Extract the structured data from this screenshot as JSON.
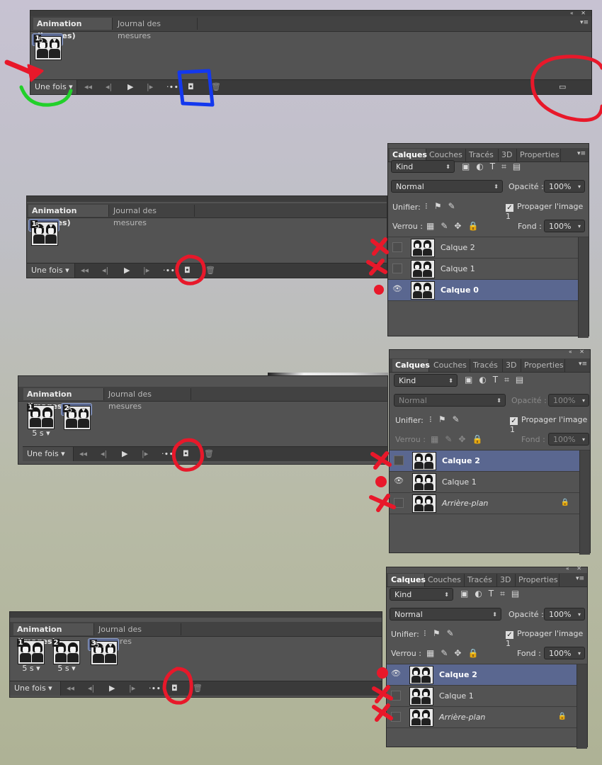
{
  "tabs": {
    "animation": "Animation (images)",
    "journal": "Journal des mesures"
  },
  "loop_label": "Une fois",
  "frame_duration": "5 s",
  "frame_numbers": [
    "1",
    "2",
    "3"
  ],
  "layer_tabs": [
    "Calques",
    "Couches",
    "Tracés",
    "3D",
    "Properties"
  ],
  "filter_kind": "Kind",
  "blend_mode": "Normal",
  "opacity_label": "Opacité :",
  "opacity_value": "100%",
  "unify_label": "Unifier:",
  "propagate_label": "Propager l'image 1",
  "lock_label": "Verrou :",
  "fill_label": "Fond :",
  "fill_value": "100%",
  "panel2": {
    "layers": [
      "Calque 2",
      "Calque 1",
      "Calque 0"
    ]
  },
  "panel3": {
    "layers": [
      "Calque 2",
      "Calque 1",
      "Arrière-plan"
    ]
  },
  "panel4": {
    "layers": [
      "Calque 2",
      "Calque 1",
      "Arrière-plan"
    ]
  }
}
